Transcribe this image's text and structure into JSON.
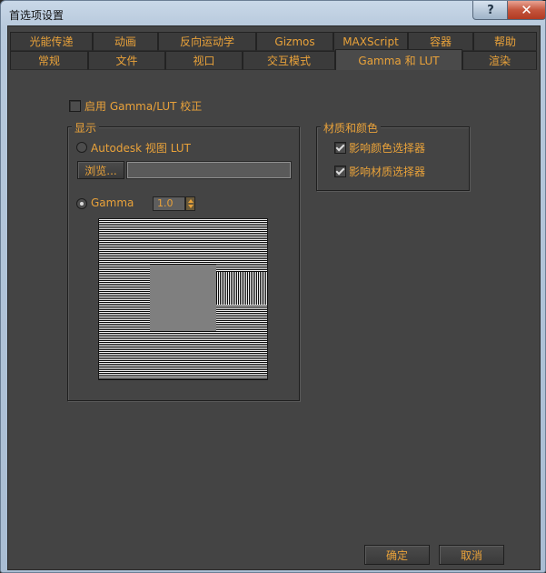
{
  "window": {
    "title": "首选项设置",
    "help_label": "?",
    "close_label": "✕"
  },
  "tabs": {
    "row1": [
      "光能传递",
      "动画",
      "反向运动学",
      "Gizmos",
      "MAXScript",
      "容器",
      "帮助"
    ],
    "row2": [
      "常规",
      "文件",
      "视口",
      "交互模式",
      "Gamma 和 LUT",
      "渲染"
    ],
    "active": "Gamma 和 LUT"
  },
  "enable_gamma": {
    "label": "启用 Gamma/LUT 校正",
    "checked": false
  },
  "display_group": {
    "title": "显示",
    "lut_radio": {
      "label": "Autodesk 视图 LUT",
      "selected": false
    },
    "browse_button": "浏览...",
    "lut_path_value": "",
    "gamma_radio": {
      "label": "Gamma",
      "selected": true
    },
    "gamma_value": "1.0"
  },
  "material_group": {
    "title": "材质和颜色",
    "affect_color_picker": {
      "label": "影响颜色选择器",
      "checked": true
    },
    "affect_material_picker": {
      "label": "影响材质选择器",
      "checked": true
    }
  },
  "buttons": {
    "ok": "确定",
    "cancel": "取消"
  },
  "colors": {
    "accent": "#e9a23a",
    "panel": "#444444",
    "titlebar": "#b7c9dc"
  }
}
